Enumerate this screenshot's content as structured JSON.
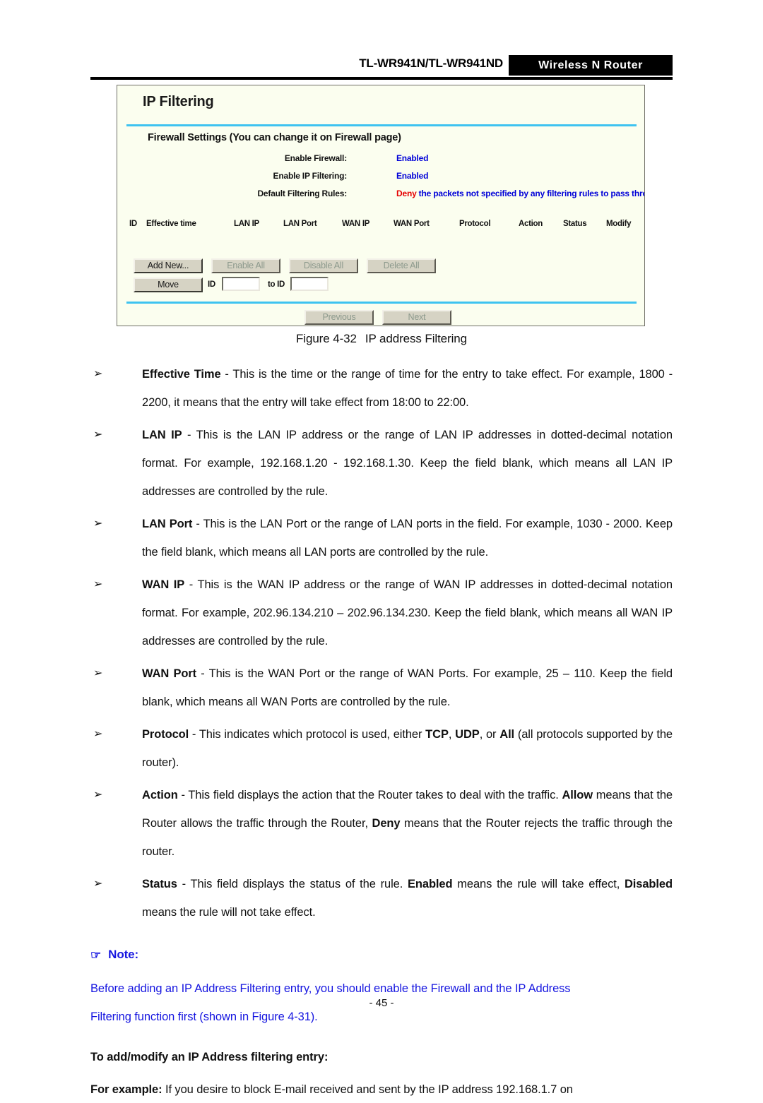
{
  "header": {
    "model": "TL-WR941N/TL-WR941ND",
    "band_label": "Wireless  N  Router"
  },
  "panel": {
    "title": "IP Filtering",
    "section_title": "Firewall Settings (You can change it on Firewall page)",
    "settings": [
      {
        "label": "Enable Firewall:",
        "value": "Enabled"
      },
      {
        "label": "Enable IP Filtering:",
        "value": "Enabled"
      }
    ],
    "default_rule": {
      "label": "Default Filtering Rules:",
      "emphasis": "Deny",
      "rest": " the packets not specified by any filtering rules to pass through the router."
    },
    "table_headers": [
      "ID",
      "Effective time",
      "LAN IP",
      "LAN Port",
      "WAN IP",
      "WAN Port",
      "Protocol",
      "Action",
      "Status",
      "Modify"
    ],
    "buttons": {
      "add_new": "Add New...",
      "enable_all": "Enable All",
      "disable_all": "Disable All",
      "delete_all": "Delete All",
      "move": "Move",
      "previous": "Previous",
      "next": "Next"
    },
    "move_row": {
      "id_label": "ID",
      "to_id_label": "to ID",
      "id_value": "",
      "to_id_value": ""
    },
    "colors": {
      "panel_bg": "#fbfeef",
      "rule_blue": "#3ec3f0",
      "value_blue": "#0000d8",
      "deny_red": "#e50000"
    }
  },
  "figure": {
    "number": "Figure 4-32",
    "caption": "IP address Filtering"
  },
  "bullets": [
    {
      "marker": "➢",
      "term": "Effective Time",
      "separator": " - ",
      "text": "This is the time or the range of time for the entry to take effect. For example, 1800 - 2200, it means that the entry will take effect from 18:00 to 22:00."
    },
    {
      "marker": "➢",
      "term": "LAN IP",
      "separator": " - ",
      "text": "This is the LAN IP address or the range of LAN IP addresses in dotted-decimal notation format. For example, 192.168.1.20 - 192.168.1.30. Keep the field blank, which means all LAN IP addresses are controlled by the rule."
    },
    {
      "marker": "➢",
      "term": "LAN Port",
      "separator": " - ",
      "text": "This is the LAN Port or the range of LAN ports in the field. For example, 1030 - 2000. Keep the field blank, which means all LAN ports are controlled by the rule."
    },
    {
      "marker": "➢",
      "term": "WAN IP",
      "separator": " - ",
      "text": "This is the WAN IP address or the range of WAN IP addresses in dotted-decimal notation format. For example, 202.96.134.210 – 202.96.134.230. Keep the field blank, which means all WAN IP addresses are controlled by the rule."
    },
    {
      "marker": "➢",
      "term": "WAN Port",
      "separator": " - ",
      "text": "This is the WAN Port or the range of WAN Ports. For example, 25 – 110. Keep the field blank, which means all WAN Ports are controlled by the rule."
    }
  ],
  "protocol_bullet": {
    "marker": "➢",
    "term": "Protocol",
    "separator": " - ",
    "part1": "This indicates which protocol is used, either ",
    "tcp": "TCP",
    "sep1": ", ",
    "udp": "UDP",
    "sep2": ", or ",
    "all": "All",
    "part2": " (all protocols supported by the router)."
  },
  "action_bullet": {
    "marker": "➢",
    "term": "Action",
    "separator": " - ",
    "part1": "This field displays the action that the Router takes to deal with the traffic. ",
    "allow": "Allow",
    "part2": " means that the Router allows the traffic through the Router, ",
    "deny": "Deny",
    "part3": " means that the Router rejects the traffic through the router."
  },
  "status_bullet": {
    "marker": "➢",
    "term": "Status",
    "separator": " - ",
    "part1": "This field displays the status of the rule. ",
    "enabled": "Enabled",
    "part2": " means the rule will take effect, ",
    "disabled": "Disabled",
    "part3": " means the rule will not take effect."
  },
  "note": {
    "icon": "☞",
    "title": "Note:",
    "body_line1": "Before adding an IP Address Filtering entry, you should enable the Firewall and the IP Address",
    "body_line2": "Filtering function first (shown in Figure 4-31)."
  },
  "sub_head": "To add/modify an IP Address filtering entry:",
  "example": {
    "label": "For example:",
    "text": " If you desire to block E-mail received and sent by the IP address 192.168.1.7 on"
  },
  "footer": "- 45 -"
}
